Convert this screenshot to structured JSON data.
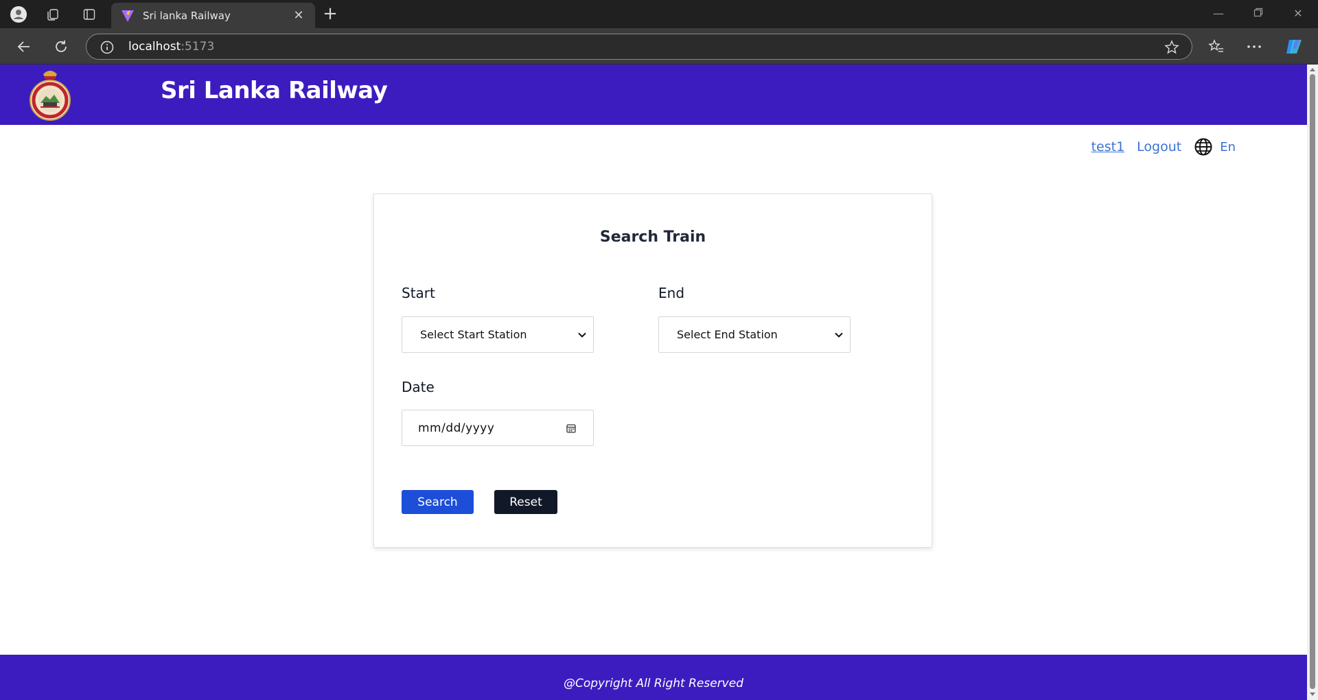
{
  "browser": {
    "tab_title": "Sri lanka Railway",
    "url_host": "localhost",
    "url_port": ":5173",
    "icons": [
      "profile-icon",
      "collections-icon",
      "tab-actions-icon",
      "vite-favicon",
      "close-icon",
      "new-tab-icon",
      "minimize-icon",
      "restore-icon",
      "window-close-icon",
      "back-icon",
      "refresh-icon",
      "site-info-icon",
      "favorite-star-icon",
      "favorites-icon",
      "more-icon",
      "copilot-icon"
    ]
  },
  "header": {
    "title": "Sri Lanka Railway",
    "brand_color": "#3c1cbf"
  },
  "user_nav": {
    "username": "test1",
    "logout": "Logout",
    "language": "En",
    "link_color": "#3b71d6"
  },
  "search_card": {
    "title": "Search Train",
    "start_label": "Start",
    "start_placeholder": "Select Start Station",
    "end_label": "End",
    "end_placeholder": "Select End Station",
    "date_label": "Date",
    "date_placeholder": "mm/dd/yyyy",
    "search_button": "Search",
    "reset_button": "Reset",
    "search_color": "#1d4ed8",
    "reset_color": "#111827"
  },
  "footer": {
    "text": "@Copyright All Right Reserved"
  }
}
